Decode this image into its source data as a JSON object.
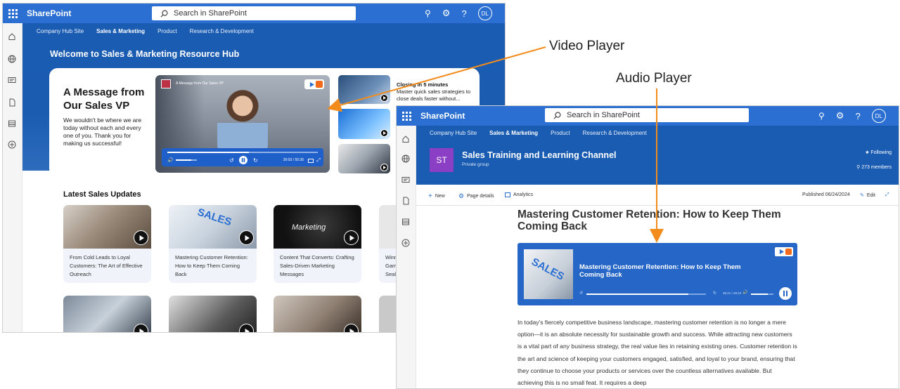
{
  "win1": {
    "brand": "SharePoint",
    "search_placeholder": "Search in SharePoint",
    "avatar_initials": "DL",
    "nav": [
      "Company Hub Site",
      "Sales & Marketing",
      "Product",
      "Research & Development"
    ],
    "active_nav_index": 1,
    "welcome": "Welcome to Sales & Marketing Resource Hub",
    "message_title": "A Message from Our Sales VP",
    "message_body": "We wouldn't be where we are today without each and every one of you. Thank you for making us successful!",
    "video": {
      "title": "A Message from Our Sales VP",
      "time": "30:03 / 55:36",
      "progress": 0.54
    },
    "closing": {
      "title": "Closing in 5 minutes",
      "body": "Master quick sales strategies to close deals faster without..."
    },
    "updates_heading": "Latest Sales Updates",
    "updates": [
      {
        "title": "From Cold Leads to Loyal Customers: The Art of Effective Outreach"
      },
      {
        "title": "Mastering Customer Retention: How to Keep Them Coming Back"
      },
      {
        "title": "Content That Converts: Crafting Sales-Driven Marketing Messages"
      },
      {
        "title": "Winn Gam Seal"
      }
    ]
  },
  "win2": {
    "brand": "SharePoint",
    "search_placeholder": "Search in SharePoint",
    "avatar_initials": "DL",
    "nav": [
      "Company Hub Site",
      "Sales & Marketing",
      "Product",
      "Research & Development"
    ],
    "site_logo": "ST",
    "site_title": "Sales Training and Learning Channel",
    "site_subtitle": "Private group",
    "following": "Following",
    "members": "273 members",
    "cmd_new": "New",
    "cmd_page_details": "Page details",
    "cmd_analytics": "Analytics",
    "published": "Published 06/24/2024",
    "edit": "Edit",
    "article_title": "Mastering Customer Retention: How to Keep Them Coming Back",
    "audio": {
      "title": "Mastering Customer Retention: How to Keep Them Coming Back",
      "time": "36:21 / 48:22",
      "progress": 0.85
    },
    "article_body": "In today's fiercely competitive business landscape, mastering customer retention is no longer a mere option—it is an absolute necessity for sustainable growth and success. While attracting new customers is a vital part of any business strategy, the real value lies in retaining existing ones. Customer retention is the art and science of keeping your customers engaged, satisfied, and loyal to your brand, ensuring that they continue to choose your products or services over the countless alternatives available. But achieving this is no small feat. It requires a deep"
  },
  "annotations": {
    "video_label": "Video Player",
    "audio_label": "Audio Player",
    "arrow_color": "#f28c1c"
  },
  "colors": {
    "suite_bar": "#2a6fd1",
    "hero": "#1a5cb2",
    "accent_orange": "#f28c1c"
  }
}
